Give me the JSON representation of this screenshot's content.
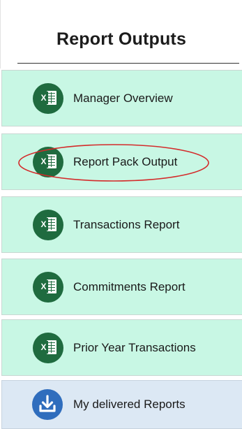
{
  "header": {
    "title": "Report Outputs"
  },
  "items": [
    {
      "label": "Manager Overview",
      "icon": "excel-icon",
      "color": "#c8f7e4"
    },
    {
      "label": "Report Pack Output",
      "icon": "excel-icon",
      "color": "#c8f7e4",
      "highlighted": true
    },
    {
      "label": "Transactions Report",
      "icon": "excel-icon",
      "color": "#c8f7e4"
    },
    {
      "label": "Commitments Report",
      "icon": "excel-icon",
      "color": "#c8f7e4"
    },
    {
      "label": "Prior Year Transactions",
      "icon": "excel-icon",
      "color": "#c8f7e4"
    },
    {
      "label": "My delivered Reports",
      "icon": "download-icon",
      "color": "#dce8f4"
    }
  ],
  "colors": {
    "excel_green": "#1f6b3f",
    "download_blue": "#2f6dbd",
    "highlight_ellipse": "#d42a2a"
  }
}
